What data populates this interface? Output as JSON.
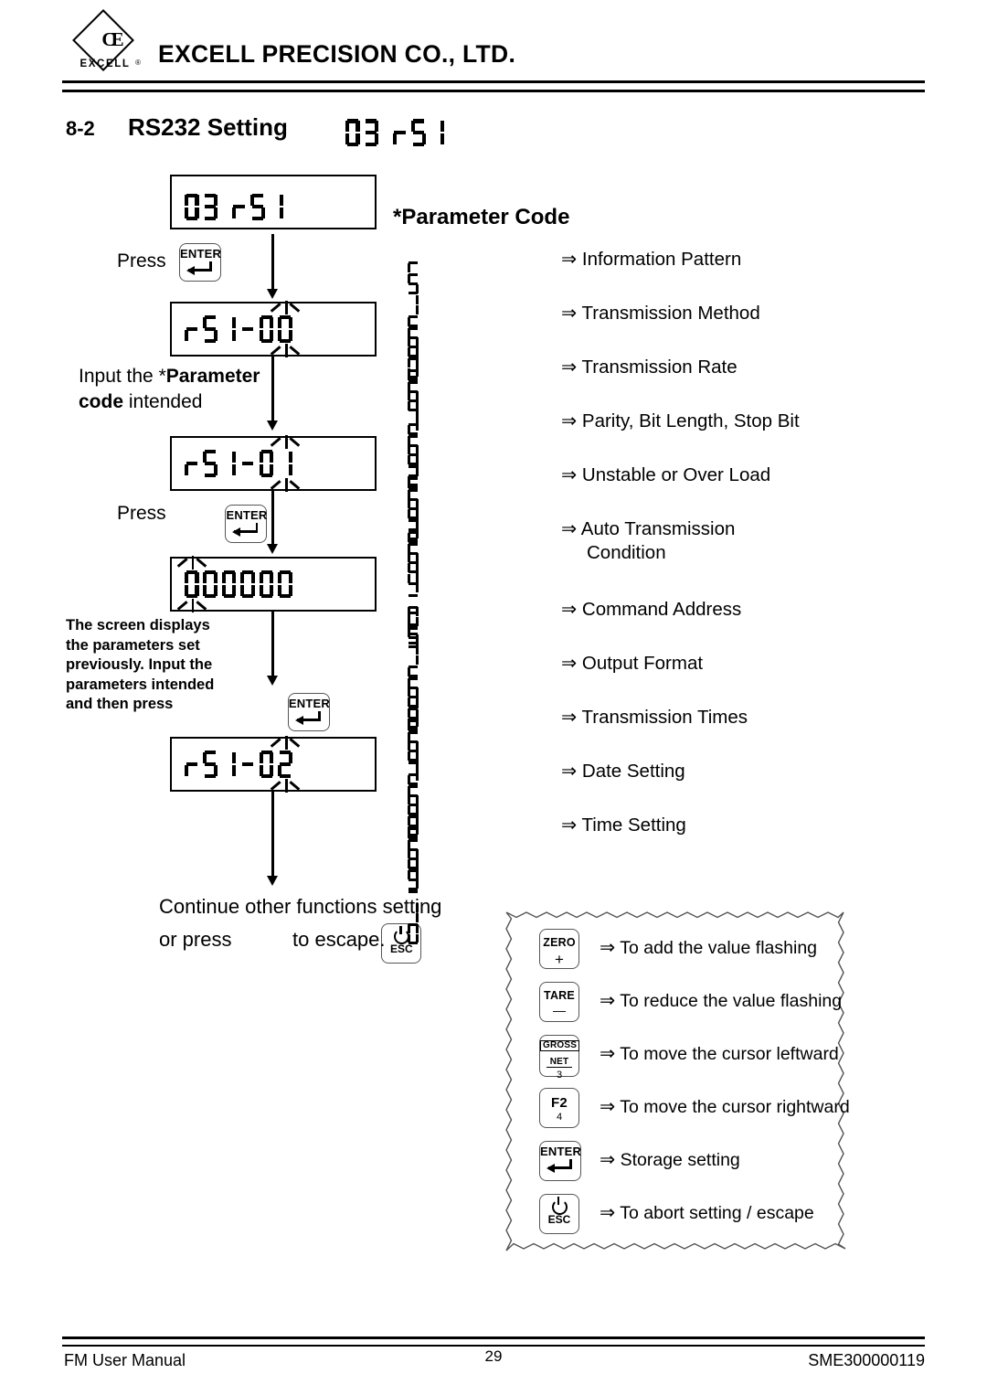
{
  "header": {
    "company": "EXCELL PRECISION CO., LTD.",
    "logo_word": "EXCELL",
    "logo_reg": "®",
    "logo_glyph": "CE"
  },
  "section": {
    "number": "8-2",
    "title": "RS232 Setting",
    "title_display": "03 rS1"
  },
  "flow": {
    "display_1": "03 rS1",
    "press_label_1": "Press",
    "display_2": "rS1-00",
    "input_text_prefix": "Input the *",
    "input_text_bold": "Parameter code",
    "input_text_suffix": " intended",
    "display_3": "rS1-01",
    "press_label_2": "Press",
    "display_4": "000000",
    "note": "The screen displays the parameters set previously. Input the parameters intended and then press",
    "note_lines": [
      "The screen displays",
      "the parameters set",
      "previously. Input the",
      "parameters intended",
      "and then press"
    ],
    "display_5": "rS1-02",
    "continue_line1": "Continue other functions setting",
    "continue_line2a": "or press",
    "continue_line2b": "to escape."
  },
  "keys": {
    "enter_label": "ENTER",
    "esc_label": "ESC",
    "zero_label": "ZERO",
    "zero_sub": "+",
    "tare_label": "TARE",
    "tare_sub": "—",
    "gross_label": "GROSS",
    "net_label": "NET",
    "gross_sub": "3",
    "f2_label": "F2",
    "f2_sub": "4"
  },
  "parameters": {
    "heading": "*Parameter Code",
    "arrow": "⇒",
    "items": [
      {
        "code": "rS1-00",
        "label": "Information Pattern",
        "label2": ""
      },
      {
        "code": "rS1-01",
        "label": "Transmission Method",
        "label2": ""
      },
      {
        "code": "rS1-02",
        "label": "Transmission Rate",
        "label2": ""
      },
      {
        "code": "rS1-03",
        "label": "Parity, Bit Length, Stop Bit",
        "label2": ""
      },
      {
        "code": "rS1-04",
        "label": "Unstable or Over Load",
        "label2": ""
      },
      {
        "code": "rS1-05",
        "label": "Auto Transmission",
        "label2": "Condition"
      },
      {
        "code": "rS1-06",
        "label": "Command Address",
        "label2": ""
      },
      {
        "code": "rS1-07",
        "label": "Output Format",
        "label2": ""
      },
      {
        "code": "rS1-08",
        "label": "Transmission Times",
        "label2": ""
      },
      {
        "code": "rS1-09",
        "label": "Date Setting",
        "label2": ""
      },
      {
        "code": "rS1-10",
        "label": "Time Setting",
        "label2": ""
      }
    ]
  },
  "legend": {
    "arrow": "⇒",
    "items": [
      {
        "key": "zero",
        "text": "To add the value flashing"
      },
      {
        "key": "tare",
        "text": "To reduce the value flashing"
      },
      {
        "key": "gross",
        "text": "To move the cursor leftward"
      },
      {
        "key": "f2",
        "text": "To move the cursor rightward"
      },
      {
        "key": "enter",
        "text": "Storage setting"
      },
      {
        "key": "esc",
        "text": "To abort setting / escape"
      }
    ]
  },
  "footer": {
    "left": "FM User Manual",
    "page": "29",
    "right": "SME300000119"
  }
}
